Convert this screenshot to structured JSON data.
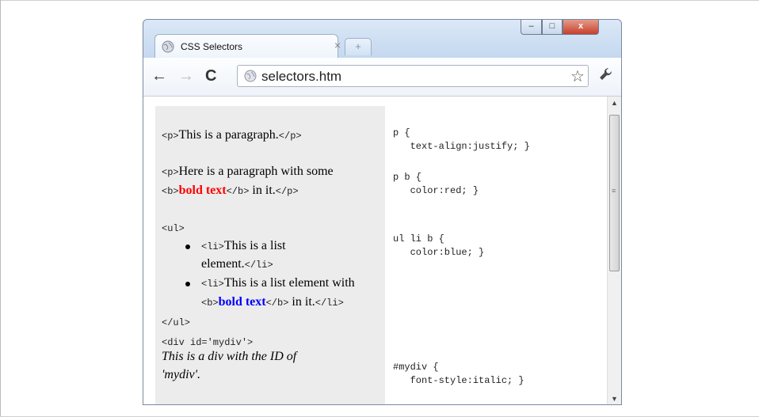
{
  "tab": {
    "title": "CSS Selectors",
    "close": "×",
    "new_tab": "+"
  },
  "window_buttons": {
    "minimize": "–",
    "maximize": "□",
    "close": "x"
  },
  "toolbar": {
    "back": "←",
    "forward": "→",
    "reload": "C",
    "url": "selectors.htm",
    "star": "☆",
    "wrench": "🔧"
  },
  "html_panel": {
    "p1_open": "<p>",
    "p1_text": "This is a paragraph.",
    "p1_close": "</p>",
    "p2_open": "<p>",
    "p2_text": "Here is a paragraph with some",
    "b_open": "<b>",
    "bold_red": "bold text",
    "b_close": "</b>",
    "p2_tail": " in it.",
    "p2_close": "</p>",
    "ul_open": "<ul>",
    "li1_open": "<li>",
    "li1_text_a": "This is a list",
    "li1_text_b": "element.",
    "li1_close": "</li>",
    "li2_open": "<li>",
    "li2_text": "This is a list element with",
    "li2_b_open": "<b>",
    "bold_blue": "bold text",
    "li2_b_close": "</b>",
    "li2_tail": " in it.",
    "li2_close": "</li>",
    "ul_close": "</ul>",
    "div_open": "<div id='mydiv'>",
    "div_text_a": "This is a div with the ID of",
    "div_text_b": "'mydiv'."
  },
  "css_panel": {
    "r1_sel": "p {",
    "r1_decl": "   text-align:justify; }",
    "r2_sel": "p b {",
    "r2_decl": "   color:red; }",
    "r3_sel": "ul li b {",
    "r3_decl": "   color:blue; }",
    "r4_sel": "#mydiv {",
    "r4_decl": "   font-style:italic; }"
  },
  "scrollbar": {
    "up": "▲",
    "down": "▼",
    "grip": "≡"
  },
  "colors": {
    "red": "#ff0000",
    "blue": "#0000ff",
    "panel": "#ececec"
  }
}
